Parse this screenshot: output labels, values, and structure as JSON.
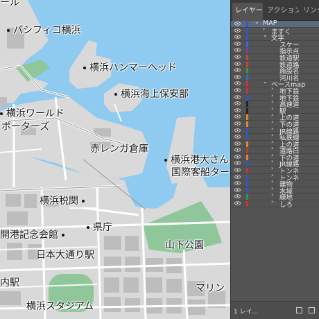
{
  "map": {
    "labels": [
      {
        "id": "label-hall-partial",
        "text": "ール"
      },
      {
        "id": "label-pacifico",
        "text": "パシフィコ横浜"
      },
      {
        "id": "label-hammerhead",
        "text": "横浜ハンマーヘッド"
      },
      {
        "id": "label-coast-guard",
        "text": "横浜海上保安部"
      },
      {
        "id": "label-world-porters-1",
        "text": "横浜ワールド"
      },
      {
        "id": "label-world-porters-2",
        "text": "ポーターズ"
      },
      {
        "id": "label-red-brick",
        "text": "赤レンガ倉庫"
      },
      {
        "id": "label-osanbashi-1",
        "text": "横浜港大さん"
      },
      {
        "id": "label-osanbashi-2",
        "text": "国際客船ター"
      },
      {
        "id": "label-customs",
        "text": "横浜税関"
      },
      {
        "id": "label-kaiko",
        "text": "開港記念会館"
      },
      {
        "id": "label-kencho",
        "text": "県庁"
      },
      {
        "id": "label-nihon-odori",
        "text": "日本大通り駅"
      },
      {
        "id": "label-yamashita",
        "text": "山下公園"
      },
      {
        "id": "label-station-partial",
        "text": "内駅"
      },
      {
        "id": "label-stadium",
        "text": "横浜スタジアム"
      },
      {
        "id": "label-marine",
        "text": "マリン"
      }
    ],
    "colors": {
      "sea": "#8fcaf0",
      "land": "#d8d8d8",
      "park": "#8fc79a",
      "road": "#ffffff",
      "building": "#bdbdbd"
    }
  },
  "panel": {
    "tabs": [
      {
        "label": "レイヤー",
        "active": true
      },
      {
        "label": "アクション",
        "active": false
      },
      {
        "label": "リンク",
        "active": false
      }
    ],
    "layers": [
      {
        "name": "MAP",
        "arrow": "v",
        "color": "#3355cc"
      },
      {
        "name": "ますく",
        "arrow": ">",
        "color": "#3355cc"
      },
      {
        "name": "文字",
        "arrow": "v",
        "color": "#3355cc"
      },
      {
        "name": "スケー",
        "arrow": "",
        "color": "#4466dd"
      },
      {
        "name": "指示点",
        "arrow": "",
        "color": "#7744aa"
      },
      {
        "name": "鉄道駅",
        "arrow": "",
        "color": "#cc4422"
      },
      {
        "name": "鉄道路",
        "arrow": "",
        "color": "#cc4422"
      },
      {
        "name": "施設名",
        "arrow": "",
        "color": "#339944"
      },
      {
        "name": "河川名",
        "arrow": "",
        "color": "#2277bb"
      },
      {
        "name": "ベースmap",
        "arrow": "v",
        "color": "#cc3333"
      },
      {
        "name": "地下鉄",
        "arrow": ">",
        "color": "#cc3333"
      },
      {
        "name": "地下鉄",
        "arrow": ">",
        "color": "#3355cc"
      },
      {
        "name": "高速道",
        "arrow": ">",
        "color": "#222222"
      },
      {
        "name": "駅",
        "arrow": ">",
        "color": "#222222"
      },
      {
        "name": "上の道",
        "arrow": ">",
        "color": "#dd8833"
      },
      {
        "name": "下の道",
        "arrow": ">",
        "color": "#dd8833"
      },
      {
        "name": "JR線路",
        "arrow": ">",
        "color": "#3355cc"
      },
      {
        "name": "私鉄線",
        "arrow": ">",
        "color": "#3355cc"
      },
      {
        "name": "上の道",
        "arrow": ">",
        "color": "#dd8833"
      },
      {
        "name": "道路白",
        "arrow": ">",
        "color": "#cc3333"
      },
      {
        "name": "下の道",
        "arrow": ">",
        "color": "#dd8833"
      },
      {
        "name": "JR線路",
        "arrow": ">",
        "color": "#3355cc"
      },
      {
        "name": "トンネ",
        "arrow": ">",
        "color": "#cc3333"
      },
      {
        "name": "トンネ",
        "arrow": ">",
        "color": "#3355cc"
      },
      {
        "name": "建物",
        "arrow": ">",
        "color": "#3355cc"
      },
      {
        "name": "水域",
        "arrow": ">",
        "color": "#3355cc"
      },
      {
        "name": "緑地",
        "arrow": ">",
        "color": "#339944"
      },
      {
        "name": "しろ",
        "arrow": ">",
        "color": "#cc3333"
      }
    ],
    "footer": {
      "text": "1 レイ..."
    }
  }
}
